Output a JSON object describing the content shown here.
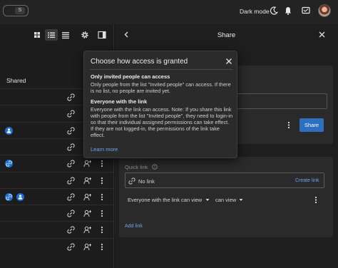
{
  "topbar": {
    "kbd_key": "S",
    "dark_mode_label": "Dark mode"
  },
  "list": {
    "header_shared": "Shared",
    "rows": [
      {
        "badges": 0
      },
      {
        "badges": 0
      },
      {
        "badges": 1
      },
      {
        "badges": 0
      },
      {
        "badges": 1
      },
      {
        "badges": 0
      },
      {
        "badges": 2
      },
      {
        "badges": 0
      },
      {
        "badges": 0
      },
      {
        "badges": 0
      }
    ]
  },
  "share": {
    "title": "Share",
    "share_button": "Share",
    "quick_link_label": "Quick link",
    "no_link": "No link",
    "create_link": "Create link",
    "access_select": "Everyone with the link can view",
    "permission_select": "can view",
    "add_link": "Add link"
  },
  "popover": {
    "title": "Choose how access is granted",
    "section1_heading": "Only invited people can access",
    "section1_text": "Only people from the list \"Invited people\" can access. If there is no list, no people are invited yet.",
    "section2_heading": "Everyone with the link",
    "section2_text": "Everyone with the link can access. Note: If you share this link with people from the list \"Invited people\", they need to login-in so that their individual assigned permissions can take effect. If they are not logged-in, the permissions of the link take effect.",
    "learn_more": "Learn more"
  },
  "colors": {
    "accent": "#2f6fbf",
    "link": "#6aa7f0",
    "badge": "#1f6fcf"
  }
}
